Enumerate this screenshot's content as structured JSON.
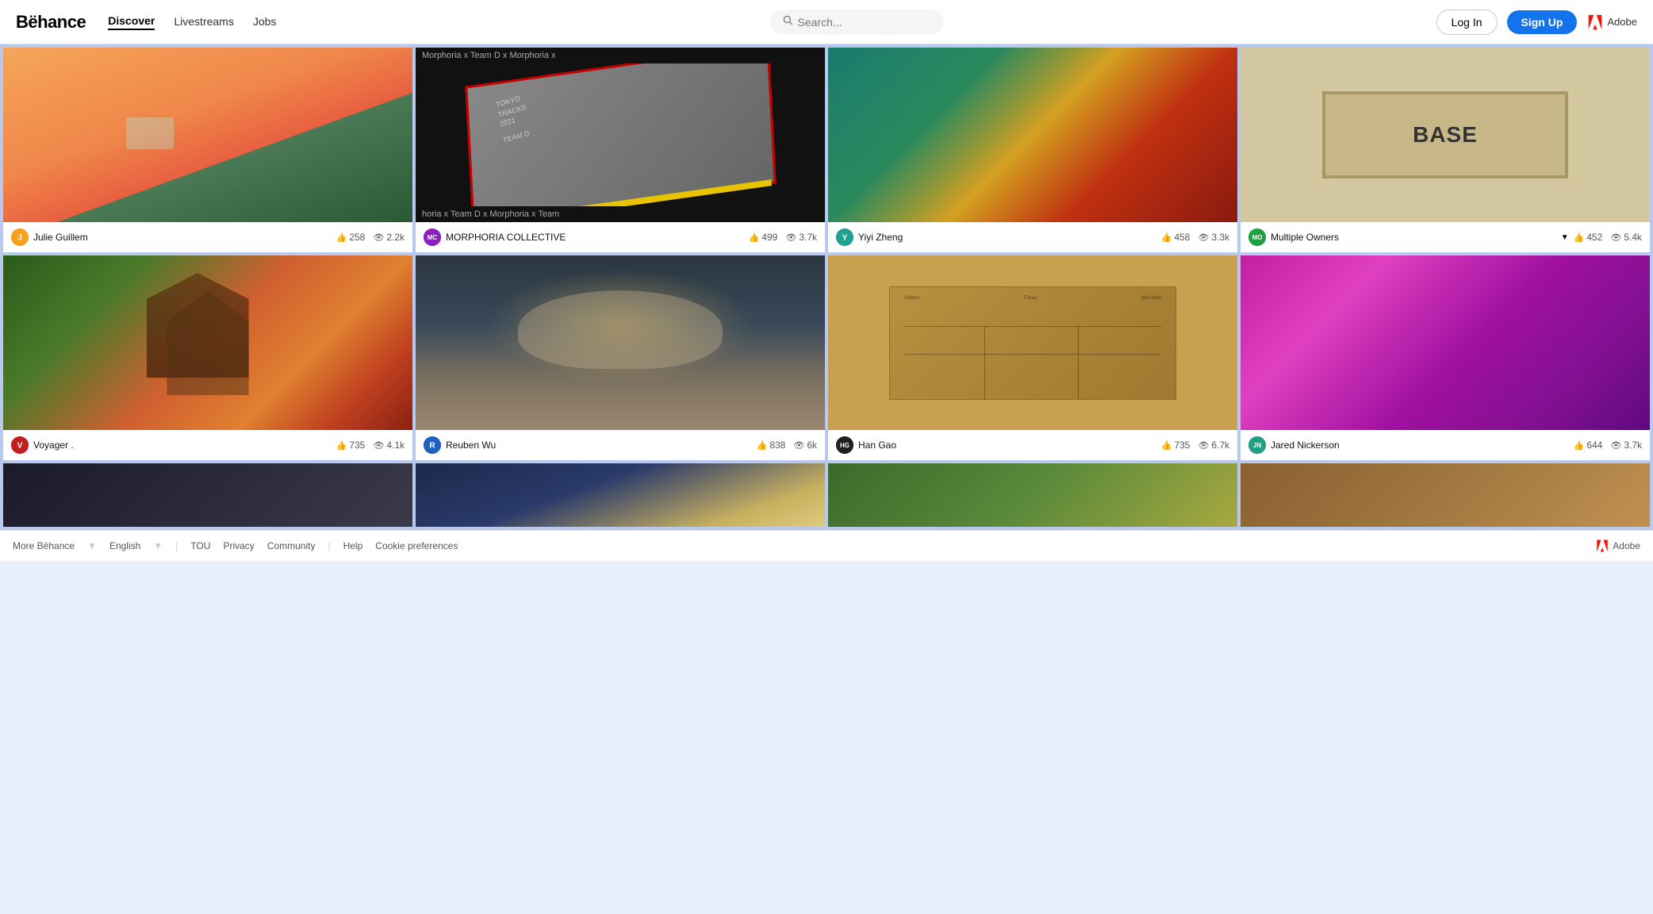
{
  "header": {
    "logo": "Bëhance",
    "nav": [
      {
        "label": "Discover",
        "active": true
      },
      {
        "label": "Livestreams",
        "active": false
      },
      {
        "label": "Jobs",
        "active": false
      }
    ],
    "search": {
      "placeholder": "Search..."
    },
    "login_label": "Log In",
    "signup_label": "Sign Up",
    "adobe_label": "Adobe"
  },
  "cards": [
    {
      "id": 1,
      "author": "Julie Guillem",
      "avatar_initials": "J",
      "avatar_color": "av-orange",
      "likes": "258",
      "views": "2.2k",
      "image_class": "img-1"
    },
    {
      "id": 2,
      "author": "MORPHORIA COLLECTIVE",
      "avatar_initials": "M",
      "avatar_color": "av-purple",
      "likes": "499",
      "views": "3.7k",
      "image_class": "img-2",
      "has_book": true
    },
    {
      "id": 3,
      "author": "Yiyi Zheng",
      "avatar_initials": "Y",
      "avatar_color": "av-teal",
      "likes": "458",
      "views": "3.3k",
      "image_class": "img-3"
    },
    {
      "id": 4,
      "author": "Multiple Owners",
      "avatar_initials": "M",
      "avatar_color": "av-green",
      "likes": "452",
      "views": "5.4k",
      "image_class": "img-4",
      "has_dropdown": true
    },
    {
      "id": 5,
      "author": "Voyager .",
      "avatar_initials": "V",
      "avatar_color": "av-red",
      "likes": "735",
      "views": "4.1k",
      "image_class": "img-5"
    },
    {
      "id": 6,
      "author": "Reuben Wu",
      "avatar_initials": "R",
      "avatar_color": "av-blue",
      "likes": "838",
      "views": "6k",
      "image_class": "img-6"
    },
    {
      "id": 7,
      "author": "Han Gao",
      "avatar_initials": "H",
      "avatar_color": "av-dark",
      "likes": "735",
      "views": "6.7k",
      "image_class": "img-7"
    },
    {
      "id": 8,
      "author": "Jared Nickerson",
      "avatar_initials": "J",
      "avatar_color": "av-pink",
      "likes": "644",
      "views": "3.7k",
      "image_class": "img-8"
    },
    {
      "id": 9,
      "author": "",
      "avatar_initials": "",
      "avatar_color": "av-dark",
      "likes": "",
      "views": "",
      "image_class": "img-9",
      "partial": true
    },
    {
      "id": 10,
      "author": "",
      "avatar_initials": "",
      "avatar_color": "av-blue",
      "likes": "",
      "views": "",
      "image_class": "img-10",
      "partial": true
    },
    {
      "id": 11,
      "author": "",
      "avatar_initials": "",
      "avatar_color": "av-green",
      "likes": "",
      "views": "",
      "image_class": "img-11",
      "partial": true
    },
    {
      "id": 12,
      "author": "",
      "avatar_initials": "",
      "avatar_color": "av-black",
      "likes": "",
      "views": "",
      "image_class": "img-12",
      "partial": true
    }
  ],
  "footer": {
    "more_behance": "More Bëhance",
    "language": "English",
    "tou": "TOU",
    "privacy": "Privacy",
    "community": "Community",
    "help": "Help",
    "cookie_preferences": "Cookie preferences",
    "adobe_label": "Adobe"
  }
}
